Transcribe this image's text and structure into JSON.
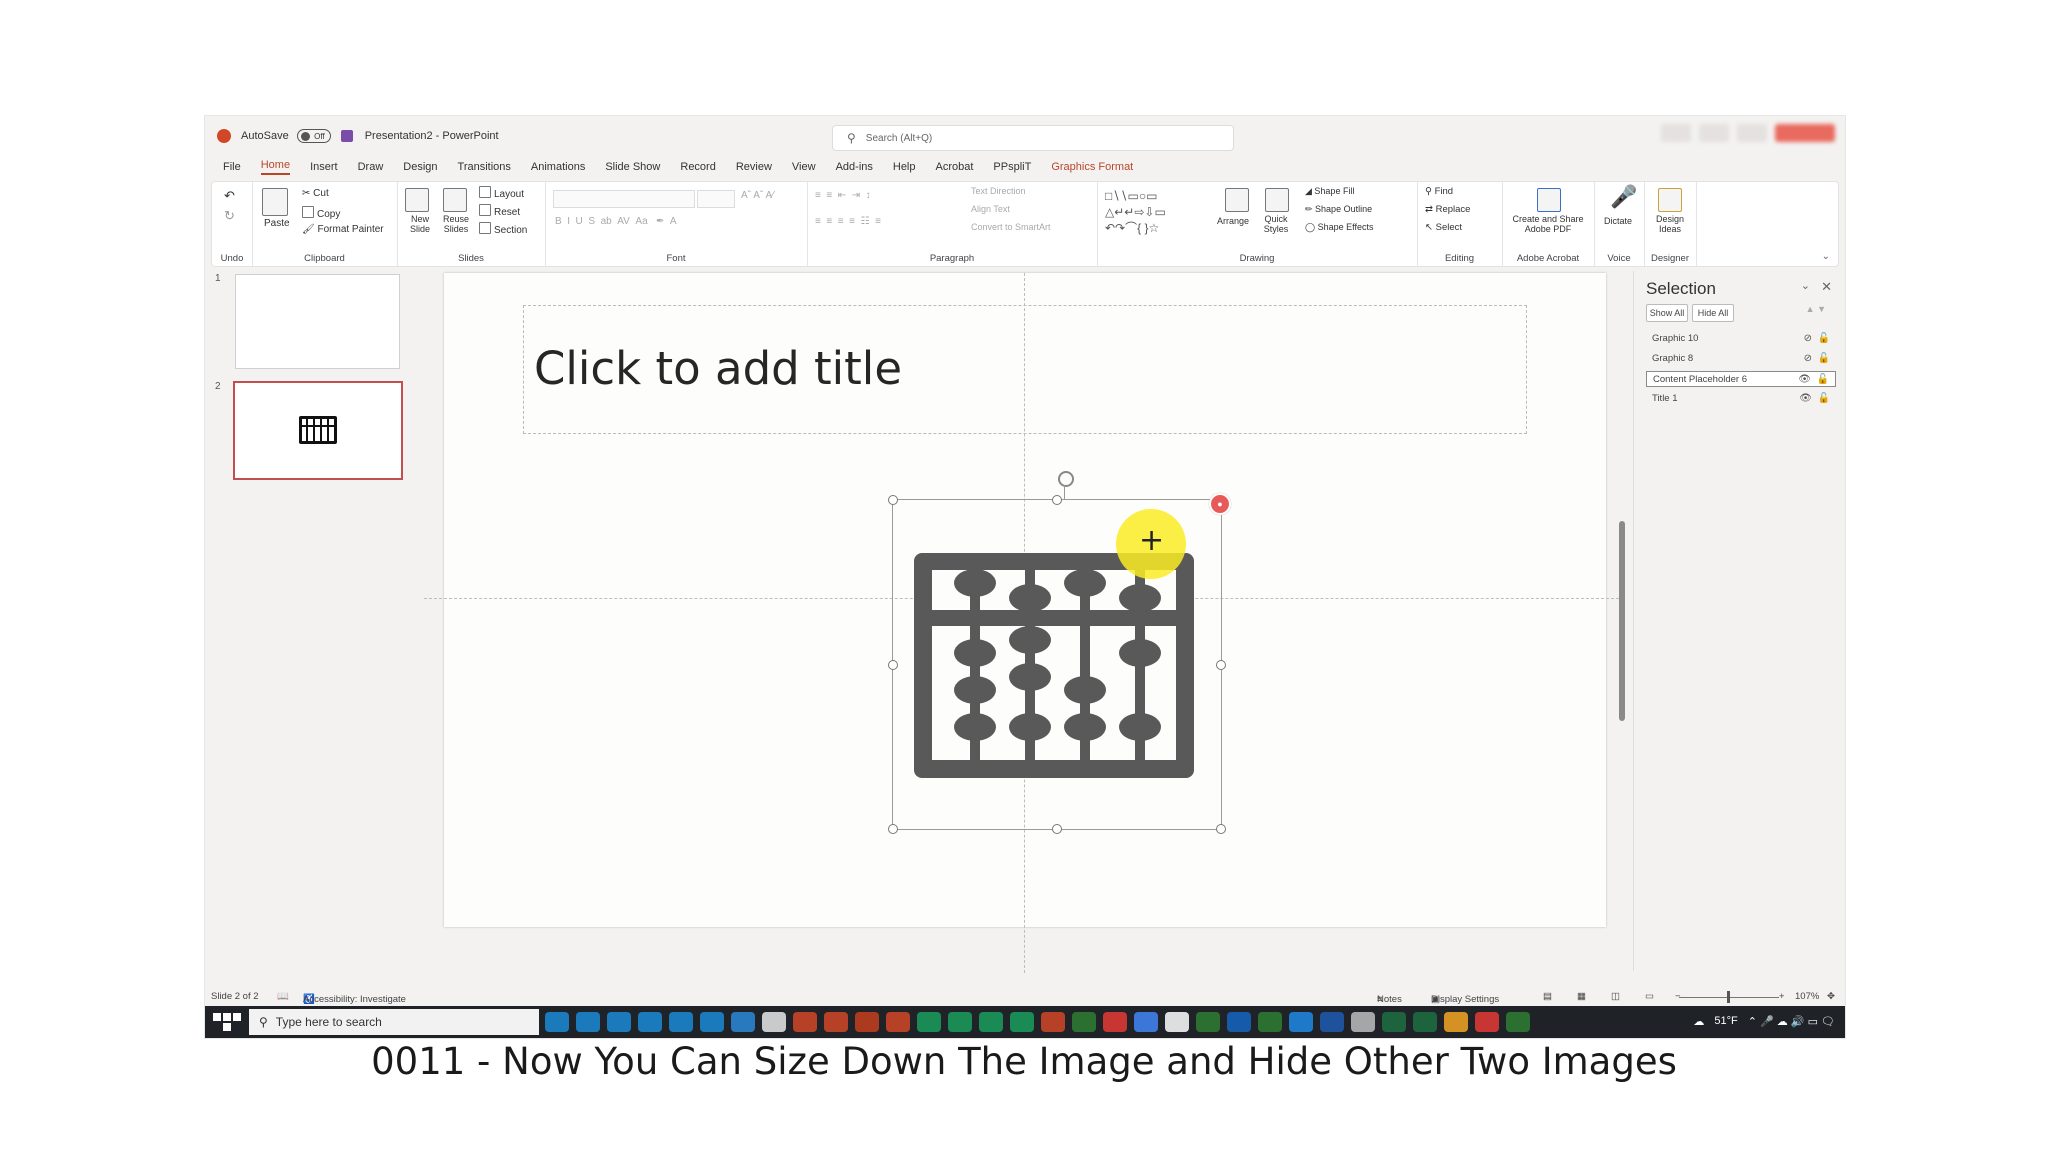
{
  "window": {
    "autosave_label": "AutoSave",
    "autosave_state": "Off",
    "doc_title": "Presentation2 - PowerPoint",
    "search_placeholder": "Search (Alt+Q)"
  },
  "tabs": [
    "File",
    "Home",
    "Insert",
    "Draw",
    "Design",
    "Transitions",
    "Animations",
    "Slide Show",
    "Record",
    "Review",
    "View",
    "Add-ins",
    "Help",
    "Acrobat",
    "PPspliT",
    "Graphics Format"
  ],
  "active_tab": "Home",
  "ribbon": {
    "undo_group": "Undo",
    "clipboard": {
      "label": "Clipboard",
      "paste": "Paste",
      "cut": "Cut",
      "copy": "Copy",
      "format_painter": "Format Painter"
    },
    "slides": {
      "label": "Slides",
      "new_slide": "New Slide",
      "reuse_slides": "Reuse Slides",
      "layout": "Layout",
      "reset": "Reset",
      "section": "Section"
    },
    "font": {
      "label": "Font"
    },
    "paragraph": {
      "label": "Paragraph",
      "text_direction": "Text Direction",
      "align_text": "Align Text",
      "convert_smartart": "Convert to SmartArt"
    },
    "drawing": {
      "label": "Drawing",
      "arrange": "Arrange",
      "quick_styles": "Quick Styles",
      "shape_fill": "Shape Fill",
      "shape_outline": "Shape Outline",
      "shape_effects": "Shape Effects"
    },
    "editing": {
      "label": "Editing",
      "find": "Find",
      "replace": "Replace",
      "select": "Select"
    },
    "acrobat": {
      "label": "Adobe Acrobat",
      "create_share": "Create and Share Adobe PDF"
    },
    "voice": {
      "label": "Voice",
      "dictate": "Dictate"
    },
    "designer": {
      "label": "Designer",
      "design_ideas": "Design Ideas"
    }
  },
  "thumbnails": [
    {
      "num": "1"
    },
    {
      "num": "2"
    }
  ],
  "slide": {
    "title_placeholder": "Click to add title"
  },
  "selection_pane": {
    "title": "Selection",
    "show_all": "Show All",
    "hide_all": "Hide All",
    "items": [
      {
        "name": "Graphic 10",
        "visible": false,
        "selected": false
      },
      {
        "name": "Graphic 8",
        "visible": false,
        "selected": false
      },
      {
        "name": "Content Placeholder 6",
        "visible": true,
        "selected": true
      },
      {
        "name": "Title 1",
        "visible": true,
        "selected": false
      }
    ]
  },
  "status": {
    "slide_info": "Slide 2 of 2",
    "accessibility": "Accessibility: Investigate",
    "notes": "Notes",
    "display_settings": "Display Settings",
    "zoom": "107%"
  },
  "taskbar": {
    "search_placeholder": "Type here to search",
    "weather": "51°F"
  },
  "caption": "0011 - Now You Can Size Down The Image and Hide Other Two Images",
  "colors": {
    "accent": "#b7472a",
    "selection_border": "#c0504d",
    "highlight": "#faeb23",
    "taskbar": "#1f2328",
    "abacus": "#595959"
  }
}
